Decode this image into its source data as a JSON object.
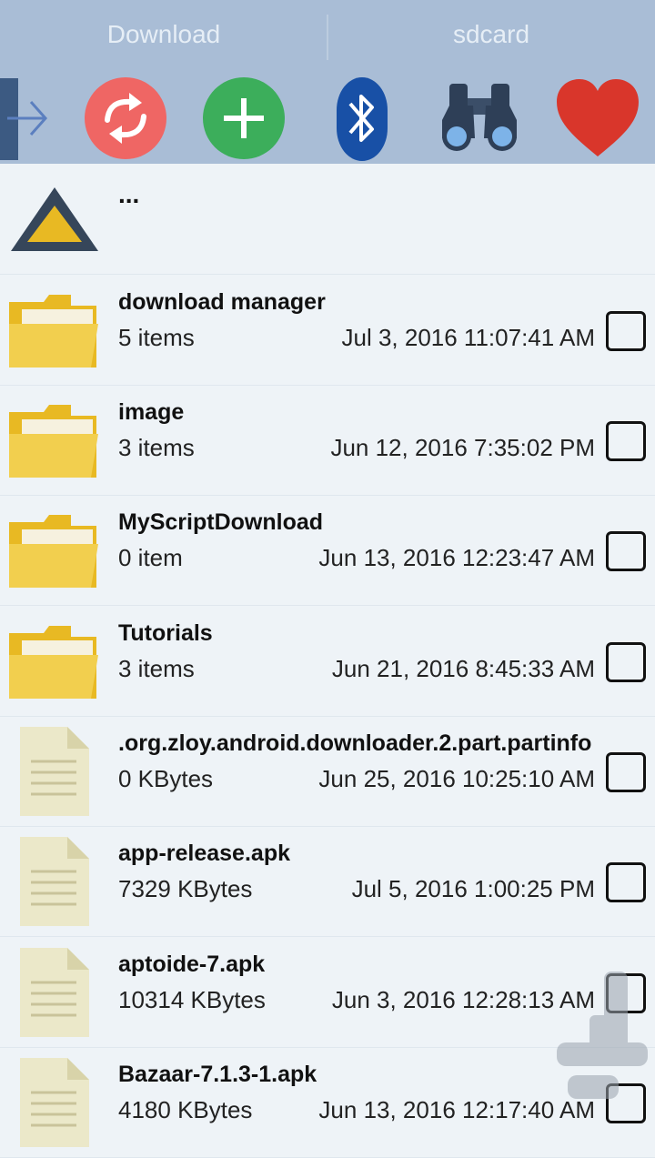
{
  "tabs": [
    {
      "label": "Download"
    },
    {
      "label": "sdcard"
    }
  ],
  "toolbar": {
    "buttons": [
      {
        "icon": "exit-arrow-icon"
      },
      {
        "icon": "refresh-icon"
      },
      {
        "icon": "add-icon"
      },
      {
        "icon": "bluetooth-icon"
      },
      {
        "icon": "binoculars-icon"
      },
      {
        "icon": "heart-icon"
      }
    ]
  },
  "parent_row": {
    "label": "..."
  },
  "items": [
    {
      "type": "folder",
      "name": "download manager",
      "sub": "5 items",
      "date": "Jul 3, 2016 11:07:41 AM"
    },
    {
      "type": "folder",
      "name": "image",
      "sub": "3 items",
      "date": "Jun 12, 2016 7:35:02 PM"
    },
    {
      "type": "folder",
      "name": "MyScriptDownload",
      "sub": "0 item",
      "date": "Jun 13, 2016 12:23:47 AM"
    },
    {
      "type": "folder",
      "name": "Tutorials",
      "sub": "3 items",
      "date": "Jun 21, 2016 8:45:33 AM"
    },
    {
      "type": "file",
      "name": ".org.zloy.android.downloader.2.part.partinfo",
      "sub": "0 KBytes",
      "date": "Jun 25, 2016 10:25:10 AM"
    },
    {
      "type": "file",
      "name": "app-release.apk",
      "sub": "7329 KBytes",
      "date": "Jul 5, 2016 1:00:25 PM"
    },
    {
      "type": "file",
      "name": "aptoide-7.apk",
      "sub": "10314 KBytes",
      "date": "Jun 3, 2016 12:28:13 AM"
    },
    {
      "type": "file",
      "name": "Bazaar-7.1.3-1.apk",
      "sub": "4180 KBytes",
      "date": "Jun 13, 2016 12:17:40 AM"
    }
  ],
  "colors": {
    "header_bg": "#a9bdd6",
    "list_bg": "#eef3f7",
    "folder": "#f2cf4e",
    "file": "#ebe8c9"
  }
}
